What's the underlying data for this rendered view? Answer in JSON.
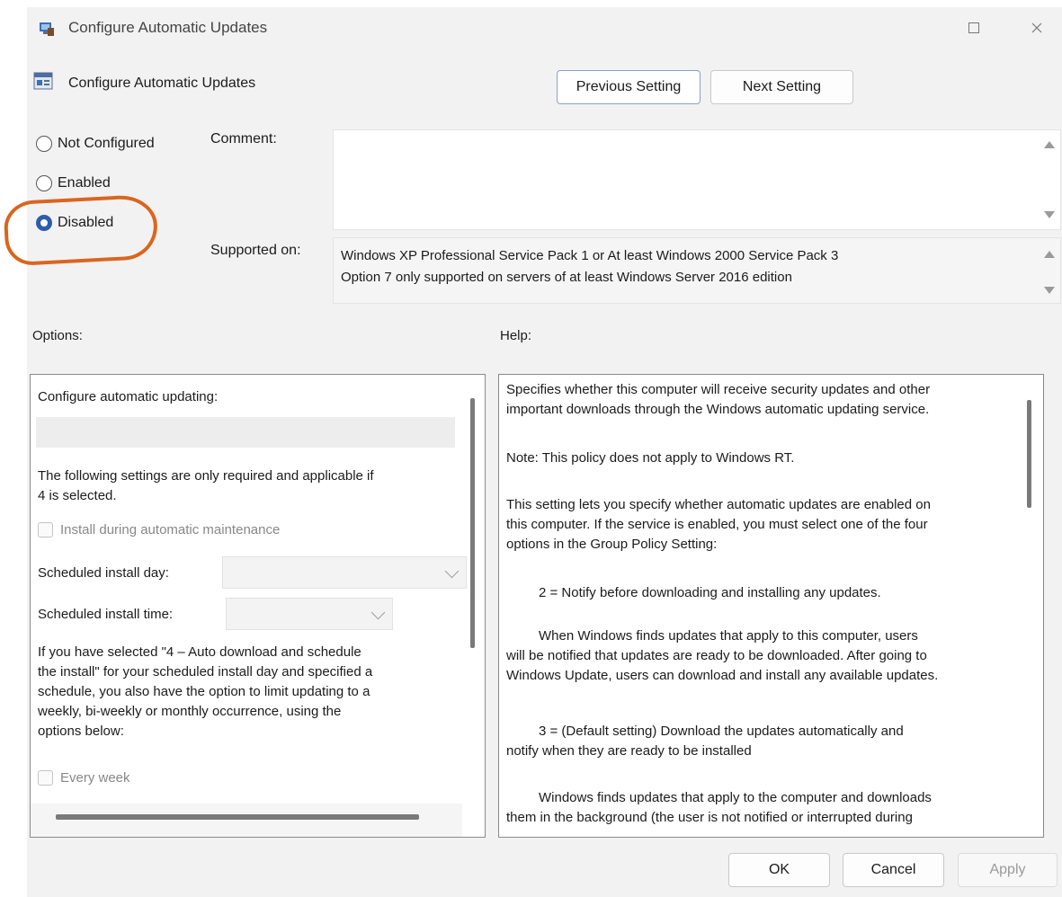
{
  "window": {
    "title": "Configure Automatic Updates"
  },
  "header": {
    "title": "Configure Automatic Updates",
    "previous_label": "Previous Setting",
    "next_label": "Next Setting"
  },
  "state": {
    "options": [
      "Not Configured",
      "Enabled",
      "Disabled"
    ],
    "selected": "Disabled"
  },
  "comment": {
    "label": "Comment:",
    "value": ""
  },
  "supported": {
    "label": "Supported on:",
    "line1": "Windows XP Professional Service Pack 1 or At least Windows 2000 Service Pack 3",
    "line2": "Option 7 only supported on servers of at least Windows Server 2016 edition"
  },
  "options_panel": {
    "label": "Options:",
    "configure_label": "Configure automatic updating:",
    "configure_value": "",
    "note_line1": "The following settings are only required and applicable if",
    "note_line2": "4 is selected.",
    "install_maintenance": "Install during automatic maintenance",
    "install_day_label": "Scheduled install day:",
    "install_day_value": "",
    "install_time_label": "Scheduled install time:",
    "install_time_value": "",
    "para_line1": "If you have selected \"4 – Auto download and schedule",
    "para_line2": "the install\" for your scheduled install day and specified a",
    "para_line3": "schedule, you also have the option to limit updating to a",
    "para_line4": "weekly, bi-weekly or monthly occurrence, using the",
    "para_line5": "options below:",
    "every_week": "Every week"
  },
  "help_panel": {
    "label": "Help:",
    "p1_line1": "Specifies whether this computer will receive security updates and other",
    "p1_line2": "important downloads through the Windows automatic updating service.",
    "p2": "Note: This policy does not apply to Windows RT.",
    "p3_line1": "This setting lets you specify whether automatic updates are enabled on",
    "p3_line2": "this computer. If the service is enabled, you must select one of the four",
    "p3_line3": "options in the Group Policy Setting:",
    "p4": "2 = Notify before downloading and installing any updates.",
    "p5_line1": "When Windows finds updates that apply to this computer, users",
    "p5_line2": "will be notified that updates are ready to be downloaded. After going to",
    "p5_line3": "Windows Update, users can download and install any available updates.",
    "p6_line1": "3 = (Default setting) Download the updates automatically and",
    "p6_line2": "notify when they are ready to be installed",
    "p7_line1": "Windows finds updates that apply to the computer and downloads",
    "p7_line2": "them in the background (the user is not notified or interrupted during"
  },
  "footer": {
    "ok_label": "OK",
    "cancel_label": "Cancel",
    "apply_label": "Apply"
  },
  "colors": {
    "accent": "#2e5ea8",
    "annotation": "#d9661f"
  }
}
